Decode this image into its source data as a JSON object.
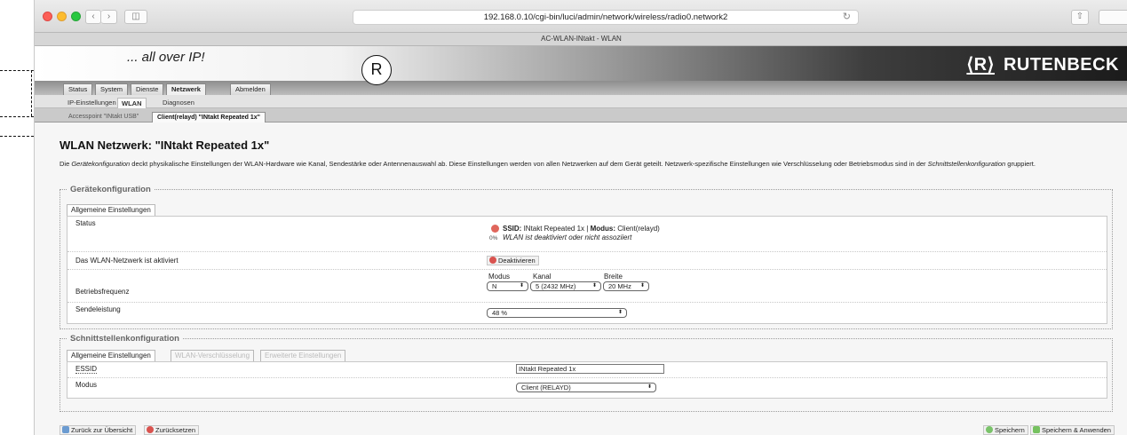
{
  "browser": {
    "url": "192.168.0.10/cgi-bin/luci/admin/network/wireless/radio0.network2",
    "tab_title": "AC-WLAN-INtakt - WLAN",
    "icons": {
      "back": "‹",
      "forward": "›",
      "sidebar": "◫",
      "reload": "↻",
      "share": "⇧"
    }
  },
  "header": {
    "slogan": "... all over IP!",
    "brand_mark": "⟨R⟩",
    "brand_name": "RUTENBECK"
  },
  "callout": {
    "label": "R"
  },
  "menu": {
    "main": [
      "Status",
      "System",
      "Dienste",
      "Netzwerk",
      "Abmelden"
    ],
    "active_main": "Netzwerk",
    "sub": [
      "IP-Einstellungen",
      "WLAN",
      "Diagnosen"
    ],
    "active_sub": "WLAN",
    "networks": [
      "Accesspoint \"INtakt USB\"",
      "Client(relayd) \"INtakt Repeated 1x\""
    ],
    "active_network": "Client(relayd) \"INtakt Repeated 1x\""
  },
  "page": {
    "title": "WLAN Netzwerk: \"INtakt Repeated 1x\"",
    "desc_1": "Die ",
    "desc_em1": "Gerätekonfiguration",
    "desc_2": " deckt physikalische Einstellungen der WLAN-Hardware wie Kanal, Sendestärke oder Antennenauswahl ab. Diese Einstellungen werden von allen Netzwerken auf dem Gerät geteilt. Netzwerk-spezifische Einstellungen wie Verschlüsselung oder Betriebsmodus sind in der ",
    "desc_em2": "Schnittstellenkonfiguration",
    "desc_3": " gruppiert."
  },
  "device_config": {
    "legend": "Gerätekonfiguration",
    "tab": "Allgemeine Einstellungen",
    "status_label": "Status",
    "status_signal": "0%",
    "ssid_label": "SSID:",
    "ssid_value": " INtakt Repeated 1x | ",
    "mode_label": "Modus:",
    "mode_value": " Client(relayd)",
    "status_note": "WLAN ist deaktiviert oder nicht assoziiert",
    "enabled_label": "Das WLAN-Netzwerk ist aktiviert",
    "deactivate_button": "Deaktivieren",
    "freq_label": "Betriebsfrequenz",
    "freq_modus_label": "Modus",
    "freq_kanal_label": "Kanal",
    "freq_breite_label": "Breite",
    "freq_modus": "N",
    "freq_kanal": "5 (2432 MHz)",
    "freq_breite": "20 MHz",
    "txpower_label": "Sendeleistung",
    "txpower": "48 %"
  },
  "iface_config": {
    "legend": "Schnittstellenkonfiguration",
    "tabs": [
      "Allgemeine Einstellungen",
      "WLAN-Verschlüsselung",
      "Erweiterte Einstellungen"
    ],
    "essid_label": "ESSID",
    "essid": "INtakt Repeated 1x",
    "mode_label": "Modus",
    "mode": "Client (RELAYD)"
  },
  "footer": {
    "back": "Zurück zur Übersicht",
    "reset": "Zurücksetzen",
    "save": "Speichern",
    "save_apply": "Speichern & Anwenden"
  }
}
